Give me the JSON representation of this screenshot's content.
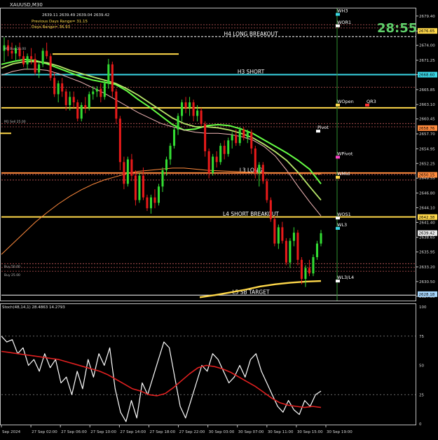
{
  "window": {
    "symbol_timeframe": "XAUUSD,M30",
    "ohlc": "2639.11 2639.49 2639.04 2639.42",
    "countdown": "28:55"
  },
  "overlay_text": [
    {
      "text": "Previous Days Range= 31.15"
    },
    {
      "text": "Days Range= 36.93"
    },
    {
      "text": "M1 Buy 25.00"
    },
    {
      "text": "M1 Sell 25.00"
    },
    {
      "text": "Buy 50.00"
    },
    {
      "text": "Buy 25.00"
    }
  ],
  "price_axis": {
    "min": 2627.0,
    "max": 2680.8,
    "ticks": [
      2679.4,
      2676.65,
      2674.0,
      2671.25,
      2668.6,
      2665.85,
      2663.1,
      2660.45,
      2657.7,
      2654.95,
      2652.25,
      2649.55,
      2646.8,
      2644.1,
      2641.4,
      2638.65,
      2635.95,
      2633.2,
      2630.5,
      2627.8
    ]
  },
  "price_tags": [
    {
      "value": 2676.65,
      "text": "2676.65",
      "color": "#ffd84a"
    },
    {
      "value": 2668.6,
      "text": "2668.60",
      "color": "#3ad7e6"
    },
    {
      "value": 2658.76,
      "text": "2658.76",
      "color": "#ff8a3d"
    },
    {
      "value": 2650.15,
      "text": "2650.15",
      "color": "#ff8a3d"
    },
    {
      "value": 2642.38,
      "text": "2642.38",
      "color": "#ffd84a"
    },
    {
      "value": 2639.42,
      "text": "2639.42",
      "color": "#e6e6e6"
    },
    {
      "value": 2628.18,
      "text": "2628.18",
      "color": "#a8d8ff"
    }
  ],
  "levels": [
    {
      "label": "H4 LONG BREAKOUT",
      "value": 2675.6,
      "color": "#ffffff",
      "style": "dash",
      "width": 1
    },
    {
      "label": "H3 SHORT",
      "value": 2668.6,
      "color": "#3ad7e6",
      "style": "solid",
      "width": 2
    },
    {
      "label": "",
      "value": 2662.5,
      "color": "#ffd84a",
      "style": "solid",
      "width": 2
    },
    {
      "label": "L3 LONG",
      "value": 2650.5,
      "color": "#ff8a3d",
      "style": "solid",
      "width": 2
    },
    {
      "label": "L4 SHORT BREAKOUT",
      "value": 2642.4,
      "color": "#ffd84a",
      "style": "solid",
      "width": 2
    },
    {
      "label": "L5 SB TARGET",
      "value": 2628.0,
      "color": "#ffffff",
      "style": "solid",
      "width": 1
    }
  ],
  "weekly_levels": [
    {
      "label": "WH3",
      "value": 2679.7,
      "color": "#3ad7e6"
    },
    {
      "label": "WOR1",
      "value": 2677.6,
      "color": "#ffffff"
    },
    {
      "label": "WOpen",
      "value": 2663.0,
      "color": "#ffd84a"
    },
    {
      "label": "QR3",
      "value": 2663.0,
      "color": "#ff3030"
    },
    {
      "label": "Pivot",
      "value": 2658.2,
      "color": "#ffffff"
    },
    {
      "label": "WPivot",
      "value": 2653.4,
      "color": "#ff44cc"
    },
    {
      "label": "WMid",
      "value": 2649.7,
      "color": "#ffd84a"
    },
    {
      "label": "WOS1",
      "value": 2642.2,
      "color": "#ffffff"
    },
    {
      "label": "WL3",
      "value": 2640.3,
      "color": "#3ad7e6"
    },
    {
      "label": "WL3/L4",
      "value": 2630.6,
      "color": "#ffffff"
    }
  ],
  "time_axis": {
    "labels": [
      "Sep 2024",
      "27 Sep 02:00",
      "27 Sep 06:00",
      "27 Sep 10:00",
      "27 Sep 14:00",
      "27 Sep 18:00",
      "27 Sep 22:00",
      "30 Sep 03:00",
      "30 Sep 07:00",
      "30 Sep 11:00",
      "30 Sep 15:00",
      "30 Sep 19:00"
    ]
  },
  "oscillator": {
    "label": "Stoch(48,14,1) 28.4863 14.2793",
    "ticks": [
      100,
      75,
      50,
      25,
      0
    ]
  },
  "chart_data": {
    "type": "line",
    "title": "XAUUSD,M30",
    "ylim": [
      2627.0,
      2680.8
    ],
    "candles": [
      {
        "o": 2673.0,
        "h": 2675.5,
        "l": 2671.0,
        "c": 2674.0
      },
      {
        "o": 2674.0,
        "h": 2675.0,
        "l": 2672.0,
        "c": 2673.0
      },
      {
        "o": 2673.0,
        "h": 2674.5,
        "l": 2671.5,
        "c": 2672.5
      },
      {
        "o": 2672.5,
        "h": 2674.0,
        "l": 2671.0,
        "c": 2673.5
      },
      {
        "o": 2673.5,
        "h": 2674.5,
        "l": 2671.5,
        "c": 2672.0
      },
      {
        "o": 2672.0,
        "h": 2673.0,
        "l": 2670.0,
        "c": 2670.5
      },
      {
        "o": 2670.5,
        "h": 2672.5,
        "l": 2669.5,
        "c": 2672.0
      },
      {
        "o": 2672.0,
        "h": 2673.5,
        "l": 2670.5,
        "c": 2671.5
      },
      {
        "o": 2671.5,
        "h": 2672.5,
        "l": 2668.5,
        "c": 2669.0
      },
      {
        "o": 2669.0,
        "h": 2671.0,
        "l": 2668.0,
        "c": 2670.5
      },
      {
        "o": 2670.5,
        "h": 2673.5,
        "l": 2670.0,
        "c": 2673.0
      },
      {
        "o": 2673.0,
        "h": 2674.5,
        "l": 2671.5,
        "c": 2672.0
      },
      {
        "o": 2672.0,
        "h": 2672.5,
        "l": 2667.5,
        "c": 2668.0
      },
      {
        "o": 2668.0,
        "h": 2669.0,
        "l": 2664.5,
        "c": 2665.0
      },
      {
        "o": 2665.0,
        "h": 2667.5,
        "l": 2663.5,
        "c": 2667.0
      },
      {
        "o": 2667.0,
        "h": 2668.0,
        "l": 2664.5,
        "c": 2665.5
      },
      {
        "o": 2665.5,
        "h": 2666.0,
        "l": 2662.0,
        "c": 2663.0
      },
      {
        "o": 2663.0,
        "h": 2665.5,
        "l": 2662.0,
        "c": 2664.5
      },
      {
        "o": 2664.5,
        "h": 2665.5,
        "l": 2662.5,
        "c": 2663.5
      },
      {
        "o": 2663.5,
        "h": 2664.0,
        "l": 2660.0,
        "c": 2660.5
      },
      {
        "o": 2660.5,
        "h": 2663.5,
        "l": 2660.0,
        "c": 2663.0
      },
      {
        "o": 2663.0,
        "h": 2664.5,
        "l": 2661.5,
        "c": 2662.5
      },
      {
        "o": 2662.5,
        "h": 2665.5,
        "l": 2662.0,
        "c": 2665.0
      },
      {
        "o": 2665.0,
        "h": 2666.5,
        "l": 2664.0,
        "c": 2665.5
      },
      {
        "o": 2665.5,
        "h": 2666.5,
        "l": 2664.5,
        "c": 2666.0
      },
      {
        "o": 2666.0,
        "h": 2667.0,
        "l": 2663.5,
        "c": 2664.5
      },
      {
        "o": 2664.5,
        "h": 2667.5,
        "l": 2664.0,
        "c": 2667.0
      },
      {
        "o": 2667.0,
        "h": 2671.5,
        "l": 2666.0,
        "c": 2670.5
      },
      {
        "o": 2670.5,
        "h": 2671.0,
        "l": 2664.5,
        "c": 2665.5
      },
      {
        "o": 2665.5,
        "h": 2666.0,
        "l": 2659.5,
        "c": 2660.5
      },
      {
        "o": 2660.5,
        "h": 2661.0,
        "l": 2651.0,
        "c": 2652.5
      },
      {
        "o": 2652.5,
        "h": 2653.5,
        "l": 2647.5,
        "c": 2648.5
      },
      {
        "o": 2648.5,
        "h": 2653.5,
        "l": 2648.0,
        "c": 2653.0
      },
      {
        "o": 2653.0,
        "h": 2654.0,
        "l": 2649.0,
        "c": 2650.0
      },
      {
        "o": 2650.0,
        "h": 2651.0,
        "l": 2644.5,
        "c": 2645.5
      },
      {
        "o": 2645.5,
        "h": 2650.5,
        "l": 2645.0,
        "c": 2650.0
      },
      {
        "o": 2650.0,
        "h": 2651.5,
        "l": 2645.5,
        "c": 2646.0
      },
      {
        "o": 2646.0,
        "h": 2646.5,
        "l": 2643.5,
        "c": 2644.0
      },
      {
        "o": 2644.0,
        "h": 2646.5,
        "l": 2643.0,
        "c": 2646.0
      },
      {
        "o": 2646.0,
        "h": 2647.5,
        "l": 2644.0,
        "c": 2645.0
      },
      {
        "o": 2645.0,
        "h": 2648.5,
        "l": 2644.5,
        "c": 2648.0
      },
      {
        "o": 2648.0,
        "h": 2651.5,
        "l": 2647.0,
        "c": 2651.0
      },
      {
        "o": 2651.0,
        "h": 2653.5,
        "l": 2650.0,
        "c": 2653.0
      },
      {
        "o": 2653.0,
        "h": 2656.0,
        "l": 2652.0,
        "c": 2655.5
      },
      {
        "o": 2655.5,
        "h": 2659.0,
        "l": 2655.0,
        "c": 2658.5
      },
      {
        "o": 2658.5,
        "h": 2661.5,
        "l": 2657.5,
        "c": 2661.0
      },
      {
        "o": 2661.0,
        "h": 2664.0,
        "l": 2660.0,
        "c": 2663.5
      },
      {
        "o": 2663.5,
        "h": 2664.5,
        "l": 2661.5,
        "c": 2662.5
      },
      {
        "o": 2662.5,
        "h": 2664.5,
        "l": 2661.0,
        "c": 2663.5
      },
      {
        "o": 2663.5,
        "h": 2664.0,
        "l": 2660.0,
        "c": 2661.0
      },
      {
        "o": 2661.0,
        "h": 2663.0,
        "l": 2660.0,
        "c": 2662.0
      },
      {
        "o": 2662.0,
        "h": 2662.5,
        "l": 2659.0,
        "c": 2659.5
      },
      {
        "o": 2659.5,
        "h": 2660.0,
        "l": 2653.5,
        "c": 2654.5
      },
      {
        "o": 2654.5,
        "h": 2655.0,
        "l": 2649.5,
        "c": 2650.5
      },
      {
        "o": 2650.5,
        "h": 2654.0,
        "l": 2650.0,
        "c": 2653.5
      },
      {
        "o": 2653.5,
        "h": 2654.5,
        "l": 2651.5,
        "c": 2652.5
      },
      {
        "o": 2652.5,
        "h": 2656.0,
        "l": 2652.0,
        "c": 2655.5
      },
      {
        "o": 2655.5,
        "h": 2656.5,
        "l": 2653.0,
        "c": 2654.0
      },
      {
        "o": 2654.0,
        "h": 2657.0,
        "l": 2653.5,
        "c": 2656.5
      },
      {
        "o": 2656.5,
        "h": 2658.0,
        "l": 2655.0,
        "c": 2657.5
      },
      {
        "o": 2657.5,
        "h": 2658.5,
        "l": 2655.5,
        "c": 2656.0
      },
      {
        "o": 2656.0,
        "h": 2659.0,
        "l": 2655.5,
        "c": 2658.5
      },
      {
        "o": 2658.5,
        "h": 2659.0,
        "l": 2656.5,
        "c": 2657.0
      },
      {
        "o": 2657.0,
        "h": 2658.5,
        "l": 2656.0,
        "c": 2658.0
      },
      {
        "o": 2658.0,
        "h": 2658.5,
        "l": 2654.0,
        "c": 2655.0
      },
      {
        "o": 2655.0,
        "h": 2655.5,
        "l": 2649.5,
        "c": 2650.5
      },
      {
        "o": 2650.5,
        "h": 2652.5,
        "l": 2648.0,
        "c": 2652.0
      },
      {
        "o": 2652.0,
        "h": 2652.5,
        "l": 2648.5,
        "c": 2649.0
      },
      {
        "o": 2649.0,
        "h": 2649.5,
        "l": 2645.0,
        "c": 2645.5
      },
      {
        "o": 2645.5,
        "h": 2646.0,
        "l": 2641.5,
        "c": 2642.0
      },
      {
        "o": 2642.0,
        "h": 2642.5,
        "l": 2637.0,
        "c": 2637.5
      },
      {
        "o": 2637.5,
        "h": 2641.0,
        "l": 2636.5,
        "c": 2640.5
      },
      {
        "o": 2640.5,
        "h": 2641.5,
        "l": 2637.5,
        "c": 2638.0
      },
      {
        "o": 2638.0,
        "h": 2638.5,
        "l": 2633.5,
        "c": 2634.0
      },
      {
        "o": 2634.0,
        "h": 2638.5,
        "l": 2633.0,
        "c": 2638.0
      },
      {
        "o": 2638.0,
        "h": 2640.5,
        "l": 2637.0,
        "c": 2639.5
      },
      {
        "o": 2639.5,
        "h": 2640.0,
        "l": 2633.5,
        "c": 2634.5
      },
      {
        "o": 2634.5,
        "h": 2635.0,
        "l": 2630.0,
        "c": 2631.0
      },
      {
        "o": 2631.0,
        "h": 2633.5,
        "l": 2629.5,
        "c": 2633.0
      },
      {
        "o": 2633.0,
        "h": 2634.5,
        "l": 2631.5,
        "c": 2632.0
      },
      {
        "o": 2632.0,
        "h": 2635.5,
        "l": 2631.5,
        "c": 2635.0
      },
      {
        "o": 2635.0,
        "h": 2638.0,
        "l": 2634.5,
        "c": 2637.5
      },
      {
        "o": 2637.5,
        "h": 2640.0,
        "l": 2637.0,
        "c": 2639.4
      }
    ],
    "series": [
      {
        "color": "#66ff44",
        "values": [
          2670.5,
          2671.0,
          2671.4,
          2671.2,
          2670.6,
          2669.8,
          2669.0,
          2668.2,
          2667.6,
          2667.2,
          2666.8,
          2665.6,
          2664.0,
          2662.6,
          2661.0,
          2659.4,
          2658.4,
          2658.6,
          2659.2,
          2659.4,
          2659.2,
          2658.6,
          2657.8,
          2656.6,
          2655.4,
          2654.2,
          2652.8,
          2651.2,
          2648.5
        ]
      },
      {
        "color": "#b8e86a",
        "values": [
          2669.8,
          2670.6,
          2671.0,
          2671.0,
          2670.8,
          2670.2,
          2669.4,
          2668.8,
          2668.2,
          2667.6,
          2667.0,
          2666.0,
          2664.8,
          2663.4,
          2662.0,
          2660.6,
          2659.6,
          2659.0,
          2659.0,
          2658.8,
          2658.4,
          2657.8,
          2657.0,
          2655.8,
          2654.4,
          2652.8,
          2650.6,
          2648.0,
          2645.5
        ]
      },
      {
        "color": "#f4b8b8",
        "values": [
          2668.5,
          2669.2,
          2669.6,
          2669.6,
          2669.4,
          2668.8,
          2668.0,
          2667.2,
          2666.2,
          2665.2,
          2664.0,
          2662.8,
          2661.6,
          2660.6,
          2659.6,
          2659.0,
          2658.4,
          2658.0,
          2657.8,
          2657.8,
          2657.6,
          2657.2,
          2656.6,
          2655.4,
          2653.6,
          2651.0,
          2648.0,
          2645.2,
          2642.6
        ]
      },
      {
        "color": "#ff8a3d",
        "values": [
          2635.5,
          2637.5,
          2639.5,
          2641.5,
          2643.2,
          2644.8,
          2646.2,
          2647.4,
          2648.4,
          2649.2,
          2649.8,
          2650.4,
          2650.8,
          2651.0,
          2651.2,
          2651.4,
          2651.4,
          2651.2,
          2651.0,
          2650.9,
          2650.8,
          2650.7,
          2650.6,
          2650.6,
          2650.5,
          2650.5,
          2650.4,
          2650.4,
          2650.3
        ]
      },
      {
        "color": "#ffd84a",
        "values": [
          2627.6,
          2628.0,
          2628.5,
          2629.0,
          2629.6,
          2630.0,
          2630.3,
          2630.5,
          2630.6
        ]
      }
    ],
    "oscillator_series": [
      {
        "name": "main",
        "color": "#ffffff",
        "values": [
          75,
          70,
          72,
          60,
          65,
          50,
          55,
          45,
          60,
          48,
          55,
          35,
          40,
          25,
          45,
          30,
          55,
          40,
          60,
          50,
          65,
          30,
          10,
          2,
          20,
          5,
          35,
          25,
          40,
          55,
          70,
          65,
          40,
          15,
          5,
          20,
          35,
          50,
          45,
          60,
          55,
          45,
          35,
          40,
          50,
          40,
          55,
          60,
          45,
          35,
          25,
          15,
          10,
          20,
          12,
          8,
          20,
          15,
          25,
          28
        ]
      },
      {
        "name": "signal",
        "color": "#e02020",
        "values": [
          62,
          61,
          60,
          59,
          58,
          57,
          56,
          55,
          53,
          51,
          49,
          47,
          45,
          42,
          38,
          34,
          30,
          28,
          25,
          24,
          26,
          31,
          37,
          43,
          48,
          50,
          49,
          47,
          44,
          40,
          36,
          32,
          27,
          22,
          18,
          16,
          15,
          14,
          15,
          14
        ]
      }
    ]
  }
}
